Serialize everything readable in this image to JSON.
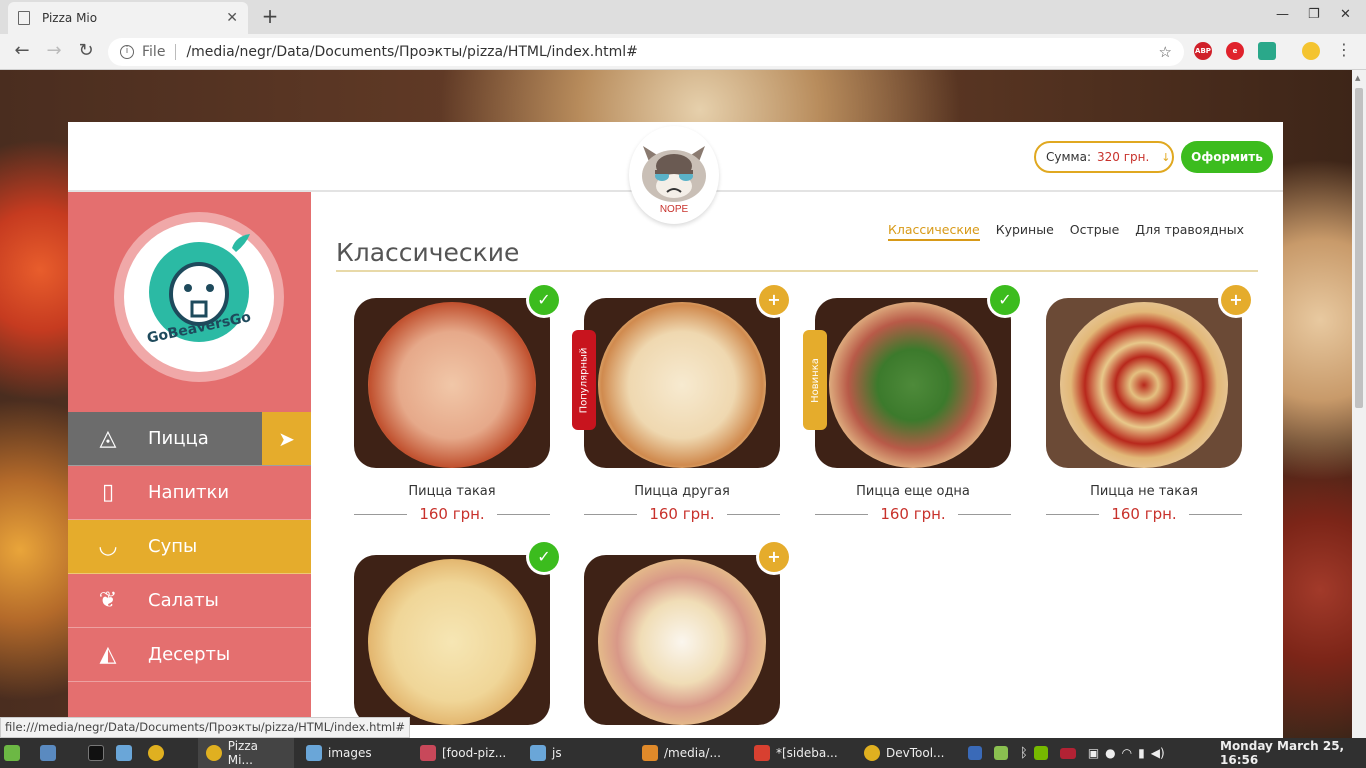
{
  "browser": {
    "tab_title": "Pizza Mio",
    "tab_close": "✕",
    "new_tab": "+",
    "url_scheme": "File",
    "url": "/media/negr/Data/Documents/Проэкты/pizza/HTML/index.html#",
    "extensions": [
      "ABP",
      "e",
      "shield",
      "face"
    ],
    "status_url": "file:///media/negr/Data/Documents/Проэкты/pizza/HTML/index.html#"
  },
  "header": {
    "cat_caption": "NOPE",
    "sum_label": "Сумма:",
    "sum_value": "320 грн.",
    "sum_arrow": "↓",
    "order_button": "Оформить"
  },
  "sidebar": {
    "logo_text": "GoBeaversGo",
    "menu": [
      {
        "label": "Пицца",
        "icon": "pizza-slice-icon"
      },
      {
        "label": "Напитки",
        "icon": "cup-icon"
      },
      {
        "label": "Супы",
        "icon": "bowl-icon"
      },
      {
        "label": "Салаты",
        "icon": "salad-icon"
      },
      {
        "label": "Десерты",
        "icon": "cake-icon"
      }
    ],
    "active_arrow": "➤"
  },
  "content": {
    "subnav": [
      "Классические",
      "Куриные",
      "Острые",
      "Для травоядных"
    ],
    "title": "Классические",
    "items": [
      {
        "name": "Пицца такая",
        "price": "160 грн.",
        "state": "added",
        "badge": "✓"
      },
      {
        "name": "Пицца другая",
        "price": "160 грн.",
        "state": "add",
        "badge": "+",
        "tag": "Популярный"
      },
      {
        "name": "Пицца еще одна",
        "price": "160 грн.",
        "state": "added",
        "badge": "✓",
        "tag": "Новинка"
      },
      {
        "name": "Пицца не такая",
        "price": "160 грн.",
        "state": "add",
        "badge": "+"
      },
      {
        "name": "",
        "price": "",
        "state": "added",
        "badge": "✓"
      },
      {
        "name": "",
        "price": "",
        "state": "add",
        "badge": "+"
      }
    ]
  },
  "taskbar": {
    "items": [
      "Pizza Mi...",
      "images",
      "[food-piz...",
      "js",
      "/media/...",
      "*[sideba...",
      "DevTool..."
    ],
    "clock": "Monday March 25, 16:56"
  },
  "colors": {
    "sidebar": "#e46f6f",
    "accent_yellow": "#e5ac2c",
    "accent_green": "#3cbc1e",
    "price_red": "#c8322c",
    "tag_red": "#c8141e"
  }
}
